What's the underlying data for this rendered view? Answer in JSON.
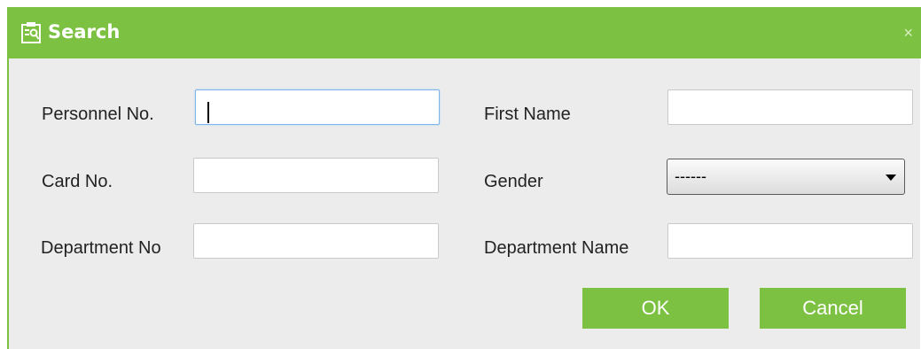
{
  "dialog": {
    "title": "Search",
    "close_glyph": "×",
    "accent_color": "#7dc142"
  },
  "form": {
    "personnel_no": {
      "label": "Personnel No.",
      "value": ""
    },
    "first_name": {
      "label": "First Name",
      "value": ""
    },
    "card_no": {
      "label": "Card No.",
      "value": ""
    },
    "gender": {
      "label": "Gender",
      "selected": "------"
    },
    "department_no": {
      "label": "Department No",
      "value": ""
    },
    "department_name": {
      "label": "Department Name",
      "value": ""
    }
  },
  "buttons": {
    "ok": "OK",
    "cancel": "Cancel"
  },
  "icons": {
    "title": "search-form-icon",
    "close": "close-icon",
    "dropdown": "chevron-down-icon"
  }
}
